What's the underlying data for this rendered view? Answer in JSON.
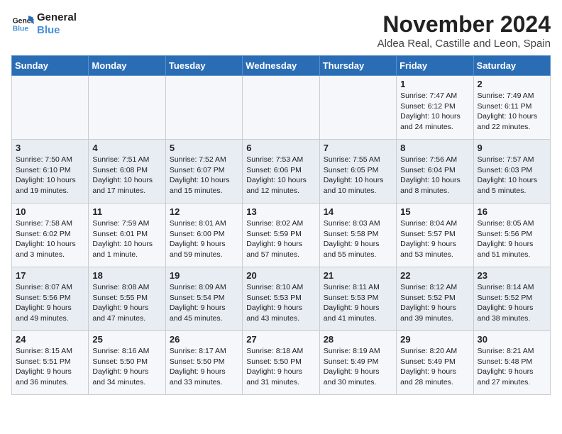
{
  "header": {
    "logo_general": "General",
    "logo_blue": "Blue",
    "month": "November 2024",
    "location": "Aldea Real, Castille and Leon, Spain"
  },
  "weekdays": [
    "Sunday",
    "Monday",
    "Tuesday",
    "Wednesday",
    "Thursday",
    "Friday",
    "Saturday"
  ],
  "weeks": [
    [
      {
        "day": "",
        "info": ""
      },
      {
        "day": "",
        "info": ""
      },
      {
        "day": "",
        "info": ""
      },
      {
        "day": "",
        "info": ""
      },
      {
        "day": "",
        "info": ""
      },
      {
        "day": "1",
        "info": "Sunrise: 7:47 AM\nSunset: 6:12 PM\nDaylight: 10 hours and 24 minutes."
      },
      {
        "day": "2",
        "info": "Sunrise: 7:49 AM\nSunset: 6:11 PM\nDaylight: 10 hours and 22 minutes."
      }
    ],
    [
      {
        "day": "3",
        "info": "Sunrise: 7:50 AM\nSunset: 6:10 PM\nDaylight: 10 hours and 19 minutes."
      },
      {
        "day": "4",
        "info": "Sunrise: 7:51 AM\nSunset: 6:08 PM\nDaylight: 10 hours and 17 minutes."
      },
      {
        "day": "5",
        "info": "Sunrise: 7:52 AM\nSunset: 6:07 PM\nDaylight: 10 hours and 15 minutes."
      },
      {
        "day": "6",
        "info": "Sunrise: 7:53 AM\nSunset: 6:06 PM\nDaylight: 10 hours and 12 minutes."
      },
      {
        "day": "7",
        "info": "Sunrise: 7:55 AM\nSunset: 6:05 PM\nDaylight: 10 hours and 10 minutes."
      },
      {
        "day": "8",
        "info": "Sunrise: 7:56 AM\nSunset: 6:04 PM\nDaylight: 10 hours and 8 minutes."
      },
      {
        "day": "9",
        "info": "Sunrise: 7:57 AM\nSunset: 6:03 PM\nDaylight: 10 hours and 5 minutes."
      }
    ],
    [
      {
        "day": "10",
        "info": "Sunrise: 7:58 AM\nSunset: 6:02 PM\nDaylight: 10 hours and 3 minutes."
      },
      {
        "day": "11",
        "info": "Sunrise: 7:59 AM\nSunset: 6:01 PM\nDaylight: 10 hours and 1 minute."
      },
      {
        "day": "12",
        "info": "Sunrise: 8:01 AM\nSunset: 6:00 PM\nDaylight: 9 hours and 59 minutes."
      },
      {
        "day": "13",
        "info": "Sunrise: 8:02 AM\nSunset: 5:59 PM\nDaylight: 9 hours and 57 minutes."
      },
      {
        "day": "14",
        "info": "Sunrise: 8:03 AM\nSunset: 5:58 PM\nDaylight: 9 hours and 55 minutes."
      },
      {
        "day": "15",
        "info": "Sunrise: 8:04 AM\nSunset: 5:57 PM\nDaylight: 9 hours and 53 minutes."
      },
      {
        "day": "16",
        "info": "Sunrise: 8:05 AM\nSunset: 5:56 PM\nDaylight: 9 hours and 51 minutes."
      }
    ],
    [
      {
        "day": "17",
        "info": "Sunrise: 8:07 AM\nSunset: 5:56 PM\nDaylight: 9 hours and 49 minutes."
      },
      {
        "day": "18",
        "info": "Sunrise: 8:08 AM\nSunset: 5:55 PM\nDaylight: 9 hours and 47 minutes."
      },
      {
        "day": "19",
        "info": "Sunrise: 8:09 AM\nSunset: 5:54 PM\nDaylight: 9 hours and 45 minutes."
      },
      {
        "day": "20",
        "info": "Sunrise: 8:10 AM\nSunset: 5:53 PM\nDaylight: 9 hours and 43 minutes."
      },
      {
        "day": "21",
        "info": "Sunrise: 8:11 AM\nSunset: 5:53 PM\nDaylight: 9 hours and 41 minutes."
      },
      {
        "day": "22",
        "info": "Sunrise: 8:12 AM\nSunset: 5:52 PM\nDaylight: 9 hours and 39 minutes."
      },
      {
        "day": "23",
        "info": "Sunrise: 8:14 AM\nSunset: 5:52 PM\nDaylight: 9 hours and 38 minutes."
      }
    ],
    [
      {
        "day": "24",
        "info": "Sunrise: 8:15 AM\nSunset: 5:51 PM\nDaylight: 9 hours and 36 minutes."
      },
      {
        "day": "25",
        "info": "Sunrise: 8:16 AM\nSunset: 5:50 PM\nDaylight: 9 hours and 34 minutes."
      },
      {
        "day": "26",
        "info": "Sunrise: 8:17 AM\nSunset: 5:50 PM\nDaylight: 9 hours and 33 minutes."
      },
      {
        "day": "27",
        "info": "Sunrise: 8:18 AM\nSunset: 5:50 PM\nDaylight: 9 hours and 31 minutes."
      },
      {
        "day": "28",
        "info": "Sunrise: 8:19 AM\nSunset: 5:49 PM\nDaylight: 9 hours and 30 minutes."
      },
      {
        "day": "29",
        "info": "Sunrise: 8:20 AM\nSunset: 5:49 PM\nDaylight: 9 hours and 28 minutes."
      },
      {
        "day": "30",
        "info": "Sunrise: 8:21 AM\nSunset: 5:48 PM\nDaylight: 9 hours and 27 minutes."
      }
    ]
  ]
}
